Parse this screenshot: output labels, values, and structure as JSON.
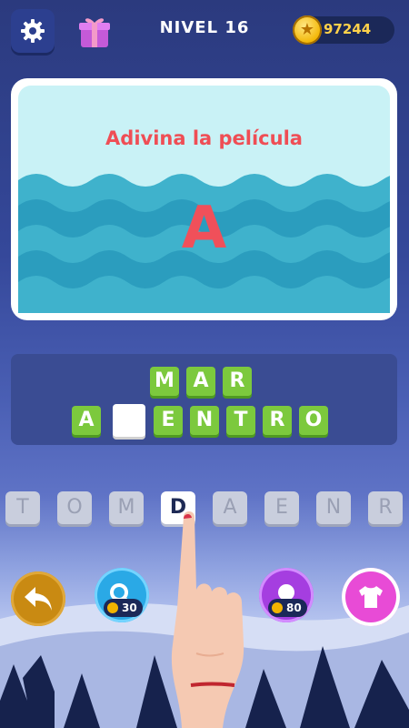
{
  "header": {
    "level": "NIVEL 16",
    "coins": "97244"
  },
  "icons": {
    "settings": "gear-icon",
    "gift": "gift-icon",
    "coin": "coin-icon",
    "back": "back-arrow-icon",
    "search": "magnifier-icon",
    "hint": "lightbulb-icon",
    "shop": "shirt-icon"
  },
  "card": {
    "prompt": "Adivina la película",
    "clue_letter": "A"
  },
  "answer": {
    "row1": [
      "M",
      "A",
      "R"
    ],
    "row2": [
      "A",
      "",
      "E",
      "N",
      "T",
      "R",
      "O"
    ]
  },
  "letter_bank": [
    "T",
    "O",
    "M",
    "D",
    "A",
    "E",
    "N",
    "R"
  ],
  "selected_letter_index": 3,
  "buttons": {
    "search_cost": "30",
    "hint_cost": "80"
  },
  "colors": {
    "tile": "#7cc93d",
    "prompt": "#ef4e55",
    "card_bg": "#c9f2f6",
    "hint": "#a53ee0",
    "shop": "#e84bd6",
    "search": "#2aa9e6",
    "back": "#c98a12"
  }
}
